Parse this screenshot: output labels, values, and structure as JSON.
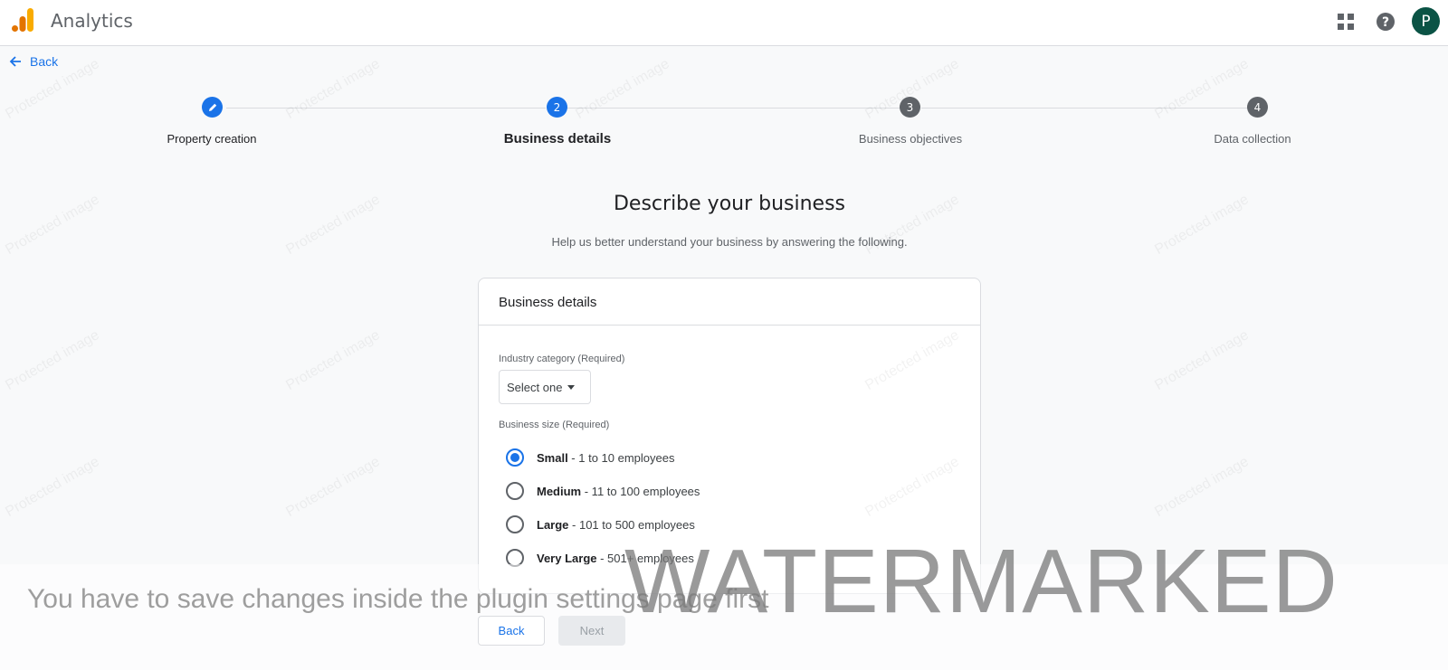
{
  "app": {
    "title": "Analytics",
    "avatar_letter": "P"
  },
  "colors": {
    "accent": "#1a73e8",
    "avatar_bg": "#0b5345",
    "step_inactive": "#5f6368"
  },
  "nav": {
    "back_label": "Back"
  },
  "stepper": {
    "steps": [
      {
        "number": "",
        "label": "Property creation",
        "state": "done"
      },
      {
        "number": "2",
        "label": "Business details",
        "state": "active"
      },
      {
        "number": "3",
        "label": "Business objectives",
        "state": "pending"
      },
      {
        "number": "4",
        "label": "Data collection",
        "state": "pending"
      }
    ]
  },
  "page": {
    "heading": "Describe your business",
    "subheading": "Help us better understand your business by answering the following."
  },
  "card": {
    "title": "Business details",
    "industry_label": "Industry category (Required)",
    "industry_value": "Select one",
    "size_label": "Business size (Required)",
    "sizes": [
      {
        "name": "Small",
        "range": " - 1 to 10 employees",
        "checked": true
      },
      {
        "name": "Medium",
        "range": " - 11 to 100 employees",
        "checked": false
      },
      {
        "name": "Large",
        "range": " - 101 to 500 employees",
        "checked": false
      },
      {
        "name": "Very Large",
        "range": " - 501+ employees",
        "checked": false
      }
    ]
  },
  "footer": {
    "back_label": "Back",
    "next_label": "Next"
  },
  "overlay": {
    "plugin_message": "You have to save changes inside the plugin settings page first",
    "watermark": "WATERMARKED",
    "protected_text": "Protected image"
  }
}
